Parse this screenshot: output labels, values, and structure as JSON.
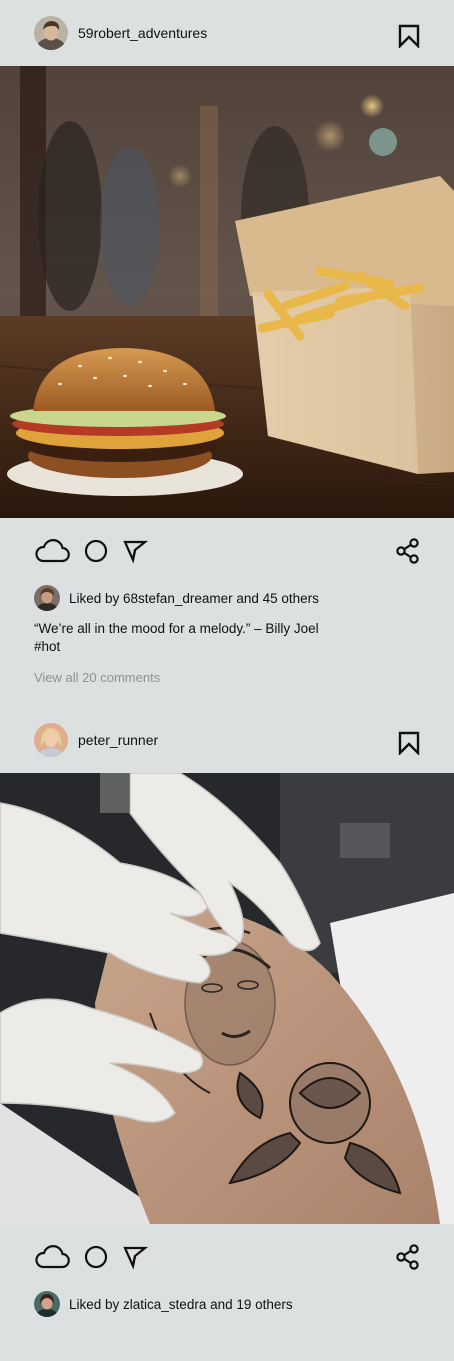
{
  "posts": [
    {
      "username": "59robert_adventures",
      "liked_by": "Liked by 68stefan_dreamer and 45 others",
      "caption_line1": "“We’re all in the mood for a melody.” – Billy Joel",
      "caption_line2": "#hot",
      "view_comments": "View all 20 comments"
    },
    {
      "username": "peter_runner",
      "liked_by": "Liked by zlatica_stedra and 19 others"
    }
  ],
  "icons": {
    "like": "cloud-icon",
    "comment": "circle-icon",
    "send": "send-arrow-icon",
    "share": "share-icon",
    "bookmark": "bookmark-icon"
  },
  "colors": {
    "background": "#dde0e0",
    "text": "#111111",
    "muted": "#8f9292"
  }
}
